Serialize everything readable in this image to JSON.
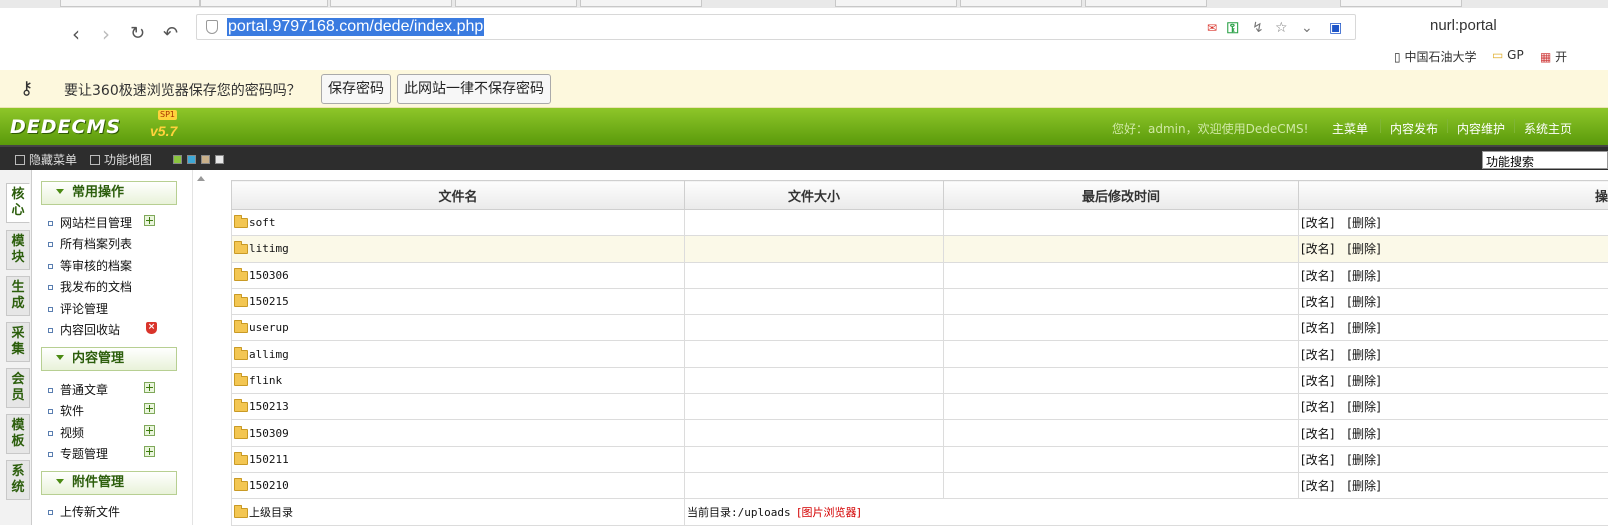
{
  "browser": {
    "url": "portal.9797168.com/dede/index.php",
    "search_query": "nurl:portal",
    "bookmarks": [
      "中国石油大学",
      "GP",
      "开"
    ]
  },
  "password_bar": {
    "message": "要让360极速浏览器保存您的密码吗？",
    "save_label": "保存密码",
    "never_label": "此网站一律不保存密码"
  },
  "cms": {
    "logo": "DEDECMS",
    "version": "v5.7",
    "sp": "SP1",
    "welcome": "您好：admin，欢迎使用DedeCMS!",
    "nav": [
      "主菜单",
      "内容发布",
      "内容维护",
      "系统主页"
    ]
  },
  "toolbar": {
    "hide_menu": "隐藏菜单",
    "function_map": "功能地图",
    "function_search": "功能搜索",
    "swatches": [
      "#8ac43f",
      "#3fa8d6",
      "#c9b08a",
      "#e8e8e8"
    ]
  },
  "vtabs": [
    "核心",
    "模块",
    "生成",
    "采集",
    "会员",
    "模板",
    "系统"
  ],
  "menu": {
    "groups": [
      {
        "title": "常用操作",
        "items": [
          "网站栏目管理",
          "所有档案列表",
          "等审核的档案",
          "我发布的文档",
          "评论管理",
          "内容回收站"
        ]
      },
      {
        "title": "内容管理",
        "items": [
          "普通文章",
          "软件",
          "视频",
          "专题管理"
        ]
      },
      {
        "title": "附件管理",
        "items": [
          "上传新文件"
        ]
      }
    ]
  },
  "file_table": {
    "columns": [
      "文件名",
      "文件大小",
      "最后修改时间",
      "操"
    ],
    "rows": [
      {
        "name": "soft",
        "actions": [
          "[改名]",
          "[删除]"
        ]
      },
      {
        "name": "litimg",
        "actions": [
          "[改名]",
          "[删除]"
        ]
      },
      {
        "name": "150306",
        "actions": [
          "[改名]",
          "[删除]"
        ]
      },
      {
        "name": "150215",
        "actions": [
          "[改名]",
          "[删除]"
        ]
      },
      {
        "name": "userup",
        "actions": [
          "[改名]",
          "[删除]"
        ]
      },
      {
        "name": "allimg",
        "actions": [
          "[改名]",
          "[删除]"
        ]
      },
      {
        "name": "flink",
        "actions": [
          "[改名]",
          "[删除]"
        ]
      },
      {
        "name": "150213",
        "actions": [
          "[改名]",
          "[删除]"
        ]
      },
      {
        "name": "150309",
        "actions": [
          "[改名]",
          "[删除]"
        ]
      },
      {
        "name": "150211",
        "actions": [
          "[改名]",
          "[删除]"
        ]
      },
      {
        "name": "150210",
        "actions": [
          "[改名]",
          "[删除]"
        ]
      }
    ],
    "footer": {
      "parent_dir": "上级目录",
      "current_dir": "当前目录:/uploads",
      "image_browser": "[图片浏览器]"
    }
  }
}
